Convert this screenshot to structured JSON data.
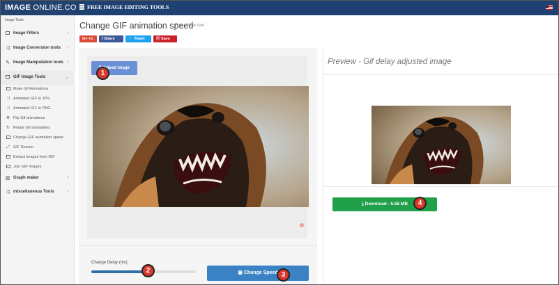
{
  "topbar": {
    "brand_bold": "IMAGE",
    "brand_rest": "ONLINE.CO",
    "title": "FREE IMAGE EDITING TOOLS"
  },
  "sidebar": {
    "heading": "Image Tools",
    "items": [
      {
        "label": "Image Filters",
        "icon": "image-icon"
      },
      {
        "label": "Image Conversion tools",
        "icon": "shuffle-icon"
      },
      {
        "label": "Image Manipulation tools",
        "icon": "wrench-icon"
      },
      {
        "label": "GIF Image Tools",
        "icon": "image-icon"
      },
      {
        "label": "Graph maker",
        "icon": "chart-icon"
      },
      {
        "label": "miscellaneous Tools",
        "icon": "shuffle-icon"
      }
    ],
    "gif_sub": [
      {
        "label": "Make Gif Animations",
        "icon": "image-icon"
      },
      {
        "label": "Animated GIF to JPG",
        "icon": "shuffle-icon"
      },
      {
        "label": "Animated GIF to PNG",
        "icon": "shuffle-icon"
      },
      {
        "label": "Flip Gif animations",
        "icon": "move-icon"
      },
      {
        "label": "Rotate Gif animations",
        "icon": "rotate-icon"
      },
      {
        "label": "Change GIF animation speed",
        "icon": "image-icon"
      },
      {
        "label": "GIF Resizer",
        "icon": "resize-icon"
      },
      {
        "label": "Extract images from GIF",
        "icon": "image-icon"
      },
      {
        "label": "Join GIF Images",
        "icon": "image-icon"
      }
    ]
  },
  "main": {
    "title": "Change GIF animation speed",
    "subtitle": "Free online tool",
    "share": {
      "google": "G+ +1",
      "facebook": "f Share",
      "twitter": "Tweet",
      "pinterest": "Save"
    },
    "upload_label": "Upload image",
    "delay_label": "Change Delay (ms)",
    "slider_fraction": 0.55,
    "change_speed_label": "Change Speed",
    "preview_title": "Preview - Gif delay adjusted image",
    "download_label": "Download - 5.58 MB"
  },
  "badges": [
    "1",
    "2",
    "3",
    "4"
  ],
  "colors": {
    "topbar": "#1f4172",
    "upload_button": "#6b8fd4",
    "change_speed_button": "#3a82c4",
    "download_button": "#21a04a",
    "badge": "#d8392b"
  }
}
